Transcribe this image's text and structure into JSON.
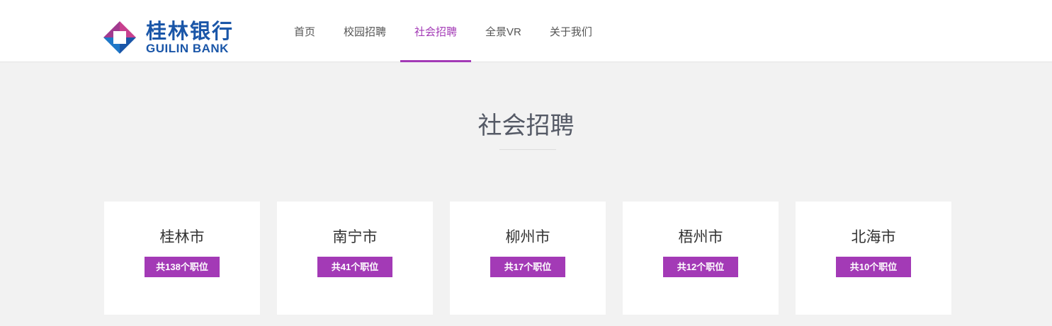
{
  "brand": {
    "name_cn": "桂林银行",
    "name_en": "GUILIN BANK",
    "logo_icon": "guilin-bank-logo-icon",
    "colors": {
      "blue": "#1a56a8",
      "magenta": "#c8408e",
      "accent": "#a33ab6"
    }
  },
  "nav": {
    "items": [
      {
        "label": "首页",
        "active": false
      },
      {
        "label": "校园招聘",
        "active": false
      },
      {
        "label": "社会招聘",
        "active": true
      },
      {
        "label": "全景VR",
        "active": false
      },
      {
        "label": "关于我们",
        "active": false
      }
    ]
  },
  "main": {
    "title": "社会招聘",
    "cities": [
      {
        "name": "桂林市",
        "count_label": "共138个职位"
      },
      {
        "name": "南宁市",
        "count_label": "共41个职位"
      },
      {
        "name": "柳州市",
        "count_label": "共17个职位"
      },
      {
        "name": "梧州市",
        "count_label": "共12个职位"
      },
      {
        "name": "北海市",
        "count_label": "共10个职位"
      }
    ]
  }
}
